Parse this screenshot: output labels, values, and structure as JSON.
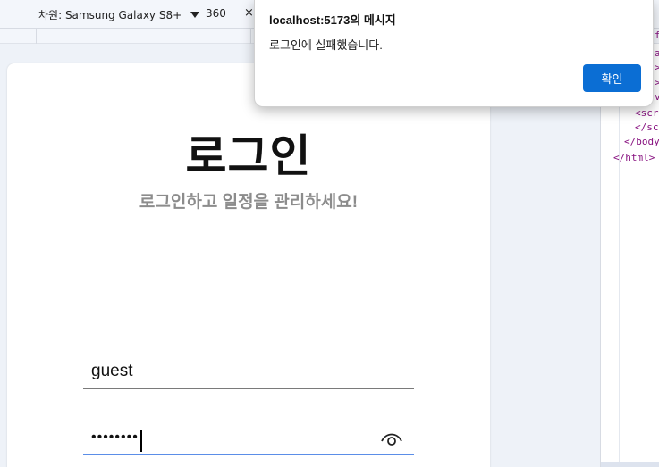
{
  "toolbar": {
    "device_label": "차원: Samsung Galaxy S8+",
    "width_value": "360",
    "times_symbol": "×"
  },
  "page": {
    "title": "로그인",
    "subtitle": "로그인하고 일정을 관리하세요!",
    "username_value": "guest",
    "password_masked": "••••••••",
    "password_icon": "eye-icon"
  },
  "devtools": {
    "lines": [
      "<scr",
      "</sc",
      "</body",
      "</html>"
    ],
    "partial_tags": [
      "f",
      "a",
      ">",
      ">",
      "v"
    ]
  },
  "dialog": {
    "title": "localhost:5173의 메시지",
    "message": "로그인에 실패했습니다.",
    "ok_label": "확인",
    "accent": "#0b6ed4"
  }
}
